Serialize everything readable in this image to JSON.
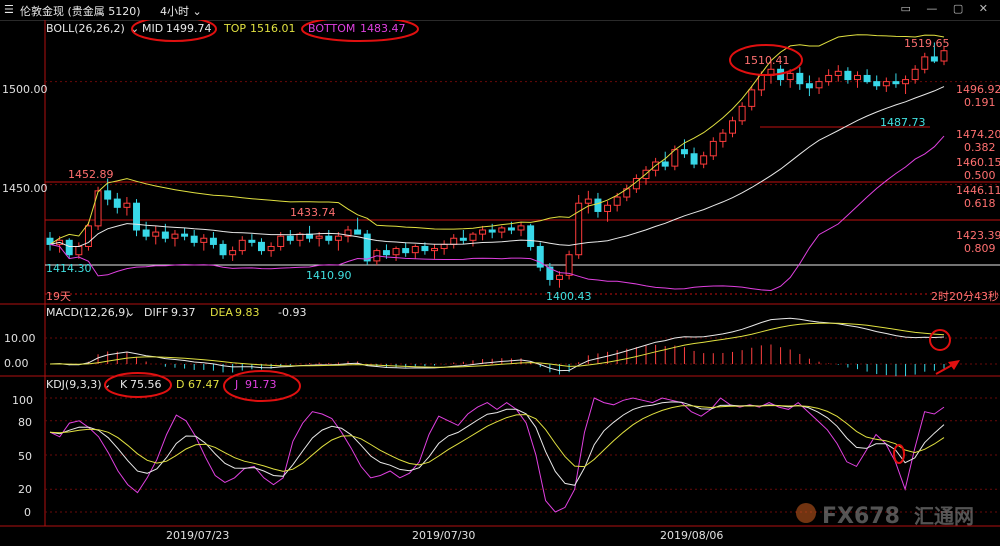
{
  "window": {
    "title": "伦敦金现 (贵金属 5120)",
    "timeframe": "4小时",
    "controls": [
      "▭",
      "—",
      "▢",
      "✕"
    ]
  },
  "chart_data": [
    {
      "type": "candlestick",
      "panel": "price",
      "indicator_label": "BOLL(26,26,2)",
      "legend": [
        {
          "label": "MID",
          "value": "1499.74",
          "color": "#e8e8e8"
        },
        {
          "label": "TOP",
          "value": "1516.01",
          "color": "#e0e040"
        },
        {
          "label": "BOTTOM",
          "value": "1483.47",
          "color": "#e040e0"
        }
      ],
      "ylim": [
        1395,
        1527
      ],
      "yticks": [
        "1500.00",
        "1450.00"
      ],
      "xticks": [
        "2019/07/23",
        "2019/07/30",
        "2019/08/06"
      ],
      "annotations": [
        {
          "text": "1452.89",
          "color": "#ff7070"
        },
        {
          "text": "1433.74",
          "color": "#ff7070"
        },
        {
          "text": "1410.90",
          "color": "#40e0e0"
        },
        {
          "text": "1414.30",
          "color": "#40e0e0"
        },
        {
          "text": "1400.43",
          "color": "#40e0e0"
        },
        {
          "text": "1510.41",
          "color": "#ff7070"
        },
        {
          "text": "1519.65",
          "color": "#ff7070"
        },
        {
          "text": "1487.73",
          "color": "#40e0e0"
        },
        {
          "text": "19天",
          "color": "#ff7070"
        },
        {
          "text": "2时20分43秒",
          "color": "#ff7070"
        }
      ],
      "fib_levels": [
        {
          "value": "1496.92",
          "ratio": "0.191"
        },
        {
          "value": "1474.20",
          "ratio": "0.382"
        },
        {
          "value": "1460.15",
          "ratio": "0.500"
        },
        {
          "value": "1446.11",
          "ratio": "0.618"
        },
        {
          "value": "1423.39",
          "ratio": "0.809"
        }
      ],
      "ohlc": [
        [
          1424,
          1427,
          1418,
          1421
        ],
        [
          1421,
          1425,
          1417,
          1423
        ],
        [
          1423,
          1424,
          1414,
          1416
        ],
        [
          1416,
          1422,
          1414,
          1420
        ],
        [
          1420,
          1432,
          1418,
          1430
        ],
        [
          1430,
          1449,
          1428,
          1447
        ],
        [
          1447,
          1453,
          1440,
          1443
        ],
        [
          1443,
          1446,
          1436,
          1439
        ],
        [
          1439,
          1444,
          1435,
          1441
        ],
        [
          1441,
          1443,
          1425,
          1428
        ],
        [
          1428,
          1432,
          1423,
          1425
        ],
        [
          1425,
          1430,
          1421,
          1427
        ],
        [
          1427,
          1431,
          1422,
          1424
        ],
        [
          1424,
          1428,
          1420,
          1426
        ],
        [
          1426,
          1429,
          1423,
          1425
        ],
        [
          1425,
          1428,
          1420,
          1422
        ],
        [
          1422,
          1426,
          1418,
          1424
        ],
        [
          1424,
          1427,
          1419,
          1421
        ],
        [
          1421,
          1423,
          1414,
          1416
        ],
        [
          1416,
          1420,
          1413,
          1418
        ],
        [
          1418,
          1425,
          1416,
          1423
        ],
        [
          1423,
          1426,
          1420,
          1422
        ],
        [
          1422,
          1424,
          1416,
          1418
        ],
        [
          1418,
          1422,
          1415,
          1420
        ],
        [
          1420,
          1427,
          1418,
          1425
        ],
        [
          1425,
          1428,
          1421,
          1423
        ],
        [
          1423,
          1427,
          1420,
          1426
        ],
        [
          1426,
          1430,
          1422,
          1424
        ],
        [
          1424,
          1427,
          1420,
          1425
        ],
        [
          1425,
          1428,
          1421,
          1423
        ],
        [
          1423,
          1427,
          1418,
          1425
        ],
        [
          1425,
          1430,
          1422,
          1428
        ],
        [
          1428,
          1434,
          1426,
          1426
        ],
        [
          1426,
          1428,
          1411,
          1413
        ],
        [
          1413,
          1419,
          1411,
          1418
        ],
        [
          1418,
          1421,
          1414,
          1416
        ],
        [
          1416,
          1420,
          1413,
          1419
        ],
        [
          1419,
          1422,
          1415,
          1417
        ],
        [
          1417,
          1421,
          1414,
          1420
        ],
        [
          1420,
          1422,
          1416,
          1418
        ],
        [
          1418,
          1421,
          1414,
          1419
        ],
        [
          1419,
          1423,
          1416,
          1421
        ],
        [
          1421,
          1426,
          1419,
          1424
        ],
        [
          1424,
          1428,
          1421,
          1423
        ],
        [
          1423,
          1427,
          1420,
          1426
        ],
        [
          1426,
          1430,
          1423,
          1428
        ],
        [
          1428,
          1431,
          1424,
          1427
        ],
        [
          1427,
          1430,
          1424,
          1429
        ],
        [
          1429,
          1432,
          1426,
          1428
        ],
        [
          1428,
          1432,
          1425,
          1430
        ],
        [
          1430,
          1431,
          1418,
          1420
        ],
        [
          1420,
          1422,
          1408,
          1410
        ],
        [
          1410,
          1412,
          1401,
          1404
        ],
        [
          1404,
          1408,
          1400,
          1406
        ],
        [
          1406,
          1418,
          1404,
          1416
        ],
        [
          1416,
          1445,
          1414,
          1441
        ],
        [
          1441,
          1447,
          1436,
          1443
        ],
        [
          1443,
          1446,
          1434,
          1437
        ],
        [
          1437,
          1442,
          1432,
          1440
        ],
        [
          1440,
          1446,
          1437,
          1444
        ],
        [
          1444,
          1450,
          1442,
          1448
        ],
        [
          1448,
          1455,
          1446,
          1453
        ],
        [
          1453,
          1459,
          1450,
          1457
        ],
        [
          1457,
          1463,
          1454,
          1461
        ],
        [
          1461,
          1466,
          1457,
          1459
        ],
        [
          1459,
          1469,
          1457,
          1467
        ],
        [
          1467,
          1472,
          1463,
          1465
        ],
        [
          1465,
          1468,
          1458,
          1460
        ],
        [
          1460,
          1466,
          1458,
          1464
        ],
        [
          1464,
          1473,
          1462,
          1471
        ],
        [
          1471,
          1477,
          1468,
          1475
        ],
        [
          1475,
          1483,
          1473,
          1481
        ],
        [
          1481,
          1490,
          1479,
          1488
        ],
        [
          1488,
          1498,
          1486,
          1496
        ],
        [
          1496,
          1505,
          1493,
          1503
        ],
        [
          1503,
          1510,
          1499,
          1506
        ],
        [
          1506,
          1508,
          1498,
          1501
        ],
        [
          1501,
          1506,
          1497,
          1504
        ],
        [
          1504,
          1507,
          1496,
          1499
        ],
        [
          1499,
          1503,
          1493,
          1497
        ],
        [
          1497,
          1502,
          1494,
          1500
        ],
        [
          1500,
          1506,
          1498,
          1503
        ],
        [
          1503,
          1508,
          1500,
          1505
        ],
        [
          1505,
          1507,
          1499,
          1501
        ],
        [
          1501,
          1505,
          1497,
          1503
        ],
        [
          1503,
          1506,
          1499,
          1500
        ],
        [
          1500,
          1503,
          1496,
          1498
        ],
        [
          1498,
          1502,
          1495,
          1500
        ],
        [
          1500,
          1504,
          1497,
          1499
        ],
        [
          1499,
          1503,
          1494,
          1501
        ],
        [
          1501,
          1508,
          1499,
          1506
        ],
        [
          1506,
          1514,
          1504,
          1512
        ],
        [
          1512,
          1519,
          1509,
          1510
        ],
        [
          1510,
          1517,
          1508,
          1515
        ]
      ]
    },
    {
      "type": "bar+line",
      "panel": "macd",
      "indicator_label": "MACD(12,26,9)",
      "legend": [
        {
          "label": "DIFF",
          "value": "9.37",
          "color": "#e8e8e8"
        },
        {
          "label": "DEA",
          "value": "9.83",
          "color": "#e0e040"
        },
        {
          "label": "",
          "value": "-0.93",
          "color": "#e040e0"
        }
      ],
      "yticks": [
        "10.00",
        "0.00"
      ]
    },
    {
      "type": "line",
      "panel": "kdj",
      "indicator_label": "KDJ(9,3,3)",
      "legend": [
        {
          "label": "K",
          "value": "75.56",
          "color": "#e8e8e8"
        },
        {
          "label": "D",
          "value": "67.47",
          "color": "#e0e040"
        },
        {
          "label": "J",
          "value": "91.73",
          "color": "#e040e0"
        }
      ],
      "yticks": [
        "100",
        "80",
        "50",
        "20",
        "0"
      ],
      "J_values": [
        70,
        66,
        78,
        80,
        74,
        66,
        52,
        36,
        24,
        17,
        30,
        46,
        68,
        85,
        80,
        66,
        48,
        32,
        26,
        30,
        38,
        40,
        30,
        24,
        30,
        62,
        78,
        88,
        86,
        82,
        70,
        56,
        40,
        30,
        32,
        36,
        30,
        34,
        44,
        68,
        84,
        80,
        76,
        86,
        92,
        96,
        90,
        96,
        90,
        78,
        50,
        10,
        0,
        4,
        20,
        70,
        100,
        96,
        94,
        98,
        100,
        98,
        96,
        100,
        98,
        96,
        88,
        84,
        90,
        100,
        94,
        92,
        94,
        92,
        96,
        92,
        90,
        96,
        88,
        80,
        72,
        60,
        44,
        40,
        54,
        68,
        60,
        44,
        20,
        56,
        88,
        86,
        92
      ]
    }
  ],
  "watermark": {
    "brand": "FX678",
    "cn": "汇通网"
  }
}
